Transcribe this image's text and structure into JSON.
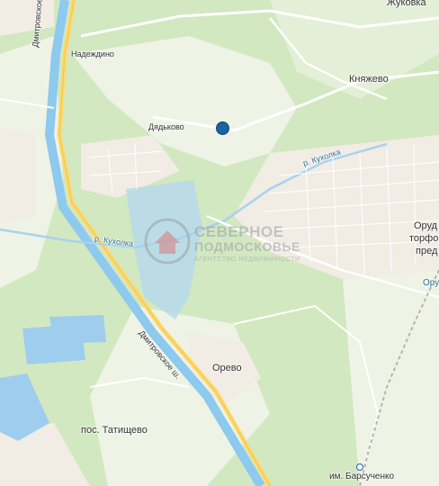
{
  "map": {
    "colors": {
      "forest": "#d2e8c0",
      "field": "#eef3e6",
      "water": "#a9d2ef",
      "road": "#ffffff",
      "highway": "#ffd96a",
      "canal": "#8ec9ee",
      "settlement": "#f1ece4"
    },
    "labels": {
      "zhukovka": "Жуковка",
      "nadezhdino": "Надеждино",
      "knyazhevo": "Княжево",
      "dyadkovo": "Дядьково",
      "river_kukholka_east": "р. Кухолка",
      "river_kukholka_west": "р. Кухолка",
      "orud_line1": "Оруд",
      "orud_line2": "торфоб",
      "orud_line3": "пред",
      "orud_right": "Оруд",
      "dmitrovskoe_top": "Дмитровское ш.",
      "dmitrovskoe_mid": "Дмитровское ш.",
      "orevo": "Орево",
      "tatishchevo": "пос. Татищево",
      "barsuchenko": "им. Барсученко"
    },
    "watermark": {
      "line1": "СЕВЕРНОЕ",
      "line2": "ПОДМОСКОВЬЕ",
      "line3": "АГЕНТСТВО НЕДВИЖИМОСТИ"
    },
    "marker": "location-marker"
  }
}
